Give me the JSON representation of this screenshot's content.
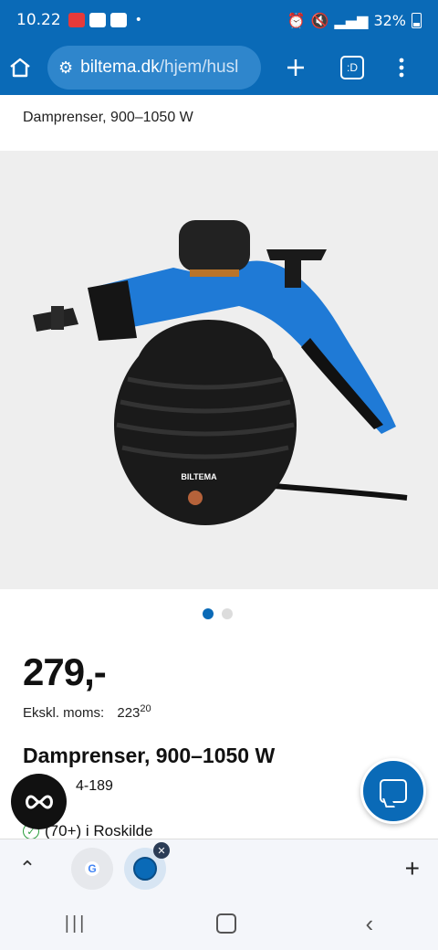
{
  "status": {
    "time": "10.22",
    "battery": "32%"
  },
  "browser": {
    "url_host": "biltema.dk",
    "url_path": "/hjem/husl",
    "tab_count": ":D"
  },
  "product": {
    "header_subtitle": "Damprenser, 900–1050 W",
    "price": "279,-",
    "excl_label": "Ekskl. moms:",
    "excl_value": "223",
    "excl_cents": "20",
    "title": "Damprenser, 900–1050 W",
    "sku": "4-189",
    "stock": "(70+) i Roskilde",
    "brand_logo": "BILTEMA"
  },
  "carousel": {
    "active_index": 0,
    "count": 2
  },
  "tabstrip": {
    "google_label": "G"
  },
  "colors": {
    "brand_blue": "#0a6ab7",
    "steam_blue": "#1f7ad6"
  },
  "icons": [
    "home-icon",
    "tune-icon",
    "plus-icon",
    "tab-switcher-icon",
    "menu-icon",
    "chat-icon",
    "carousel-dot"
  ]
}
